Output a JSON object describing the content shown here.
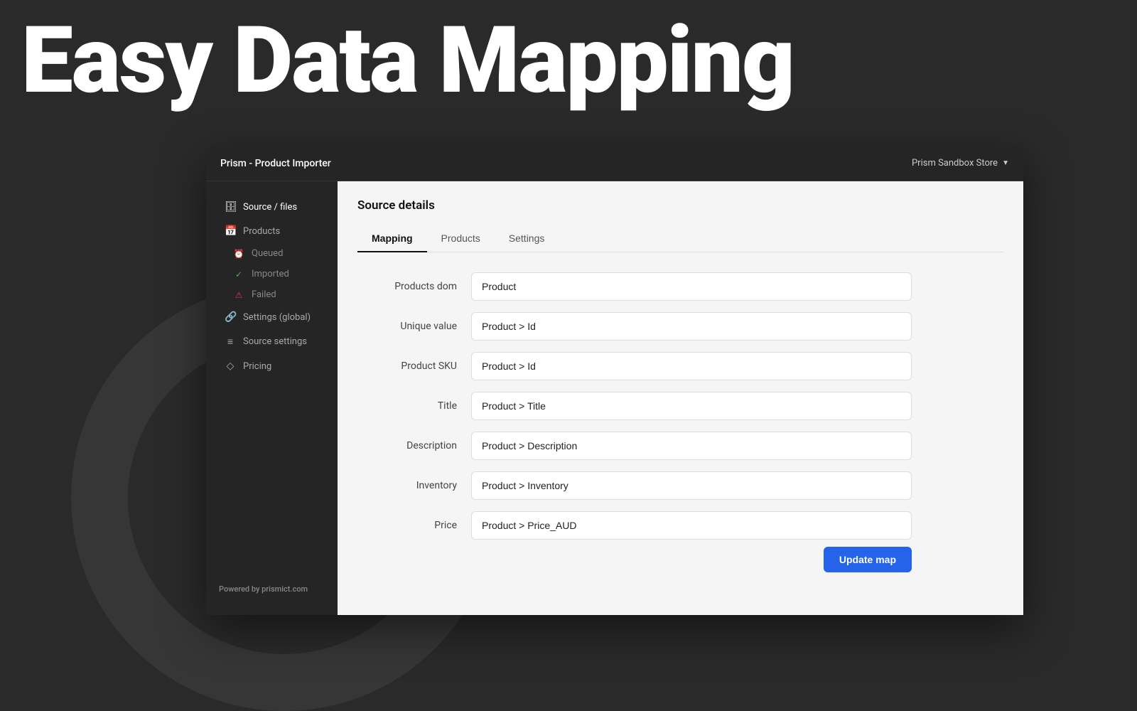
{
  "hero": {
    "title": "Easy Data Mapping"
  },
  "titleBar": {
    "appName": "Prism - Product Importer",
    "storeName": "Prism Sandbox Store"
  },
  "sidebar": {
    "items": [
      {
        "id": "source-files",
        "label": "Source / files",
        "icon": "🗄"
      },
      {
        "id": "products",
        "label": "Products",
        "icon": "📅"
      }
    ],
    "subItems": [
      {
        "id": "queued",
        "label": "Queued",
        "icon": "⏰",
        "class": "queued"
      },
      {
        "id": "imported",
        "label": "Imported",
        "icon": "✓",
        "class": "imported"
      },
      {
        "id": "failed",
        "label": "Failed",
        "icon": "⚠",
        "class": "failed"
      }
    ],
    "bottomItems": [
      {
        "id": "settings-global",
        "label": "Settings (global)",
        "icon": "🔗"
      },
      {
        "id": "source-settings",
        "label": "Source settings",
        "icon": "≡"
      },
      {
        "id": "pricing",
        "label": "Pricing",
        "icon": "◇"
      }
    ],
    "footer": {
      "prefix": "Powered by ",
      "brand": "prismict.com"
    }
  },
  "mainContent": {
    "sourceTitle": "Source details",
    "tabs": [
      {
        "id": "mapping",
        "label": "Mapping",
        "active": true
      },
      {
        "id": "products",
        "label": "Products",
        "active": false
      },
      {
        "id": "settings",
        "label": "Settings",
        "active": false
      }
    ],
    "mappingForm": {
      "fields": [
        {
          "id": "products-dom",
          "label": "Products dom",
          "value": "Product"
        },
        {
          "id": "unique-value",
          "label": "Unique value",
          "value": "Product > Id"
        },
        {
          "id": "product-sku",
          "label": "Product SKU",
          "value": "Product > Id"
        },
        {
          "id": "title",
          "label": "Title",
          "value": "Product > Title"
        },
        {
          "id": "description",
          "label": "Description",
          "value": "Product > Description"
        },
        {
          "id": "inventory",
          "label": "Inventory",
          "value": "Product > Inventory"
        },
        {
          "id": "price",
          "label": "Price",
          "value": "Product > Price_AUD"
        }
      ],
      "updateButton": "Update map"
    }
  }
}
